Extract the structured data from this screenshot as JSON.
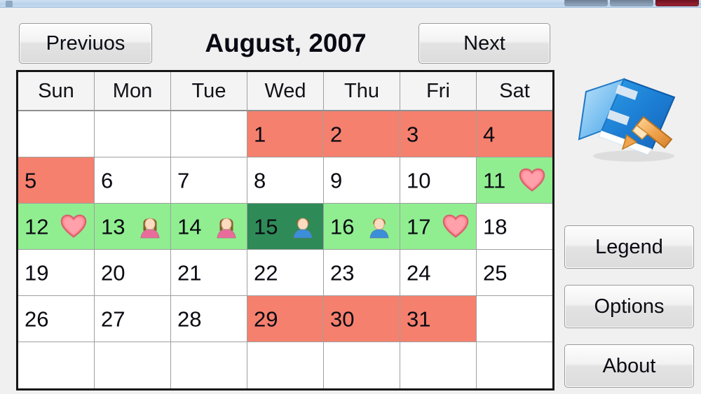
{
  "window": {
    "controls": [
      {
        "name": "minimize-button",
        "label": ""
      },
      {
        "name": "maximize-button",
        "label": ""
      },
      {
        "name": "close-button",
        "label": ""
      }
    ],
    "app_icon": "diary-book-pen-icon"
  },
  "toolbar": {
    "previous_label": "Previuos",
    "next_label": "Next",
    "month_title": "August, 2007"
  },
  "calendar": {
    "day_headers": [
      "Sun",
      "Mon",
      "Tue",
      "Wed",
      "Thu",
      "Fri",
      "Sat"
    ],
    "weeks": [
      [
        {
          "day": "",
          "state": "empty"
        },
        {
          "day": "",
          "state": "empty"
        },
        {
          "day": "",
          "state": "empty"
        },
        {
          "day": "1",
          "state": "red"
        },
        {
          "day": "2",
          "state": "red"
        },
        {
          "day": "3",
          "state": "red"
        },
        {
          "day": "4",
          "state": "red"
        }
      ],
      [
        {
          "day": "5",
          "state": "red"
        },
        {
          "day": "6",
          "state": "normal"
        },
        {
          "day": "7",
          "state": "normal"
        },
        {
          "day": "8",
          "state": "normal"
        },
        {
          "day": "9",
          "state": "normal"
        },
        {
          "day": "10",
          "state": "normal"
        },
        {
          "day": "11",
          "state": "green",
          "icon": "heart-icon"
        }
      ],
      [
        {
          "day": "12",
          "state": "green",
          "icon": "heart-icon"
        },
        {
          "day": "13",
          "state": "green",
          "icon": "female-person-icon"
        },
        {
          "day": "14",
          "state": "green",
          "icon": "female-person-icon"
        },
        {
          "day": "15",
          "state": "selected",
          "icon": "male-person-icon"
        },
        {
          "day": "16",
          "state": "green",
          "icon": "male-person-icon"
        },
        {
          "day": "17",
          "state": "green",
          "icon": "heart-icon"
        },
        {
          "day": "18",
          "state": "normal"
        }
      ],
      [
        {
          "day": "19",
          "state": "normal"
        },
        {
          "day": "20",
          "state": "normal"
        },
        {
          "day": "21",
          "state": "normal"
        },
        {
          "day": "22",
          "state": "normal"
        },
        {
          "day": "23",
          "state": "normal"
        },
        {
          "day": "24",
          "state": "normal"
        },
        {
          "day": "25",
          "state": "normal"
        }
      ],
      [
        {
          "day": "26",
          "state": "normal"
        },
        {
          "day": "27",
          "state": "normal"
        },
        {
          "day": "28",
          "state": "normal"
        },
        {
          "day": "29",
          "state": "red"
        },
        {
          "day": "30",
          "state": "red"
        },
        {
          "day": "31",
          "state": "red"
        },
        {
          "day": "",
          "state": "empty"
        }
      ],
      [
        {
          "day": "",
          "state": "empty"
        },
        {
          "day": "",
          "state": "empty"
        },
        {
          "day": "",
          "state": "empty"
        },
        {
          "day": "",
          "state": "empty"
        },
        {
          "day": "",
          "state": "empty"
        },
        {
          "day": "",
          "state": "empty"
        },
        {
          "day": "",
          "state": "empty"
        }
      ]
    ]
  },
  "sidebar": {
    "legend_label": "Legend",
    "options_label": "Options",
    "about_label": "About"
  },
  "colors": {
    "red_day": "#f5806e",
    "green_day": "#90ee90",
    "selected_day": "#2e8b57",
    "normal_day": "#ffffff",
    "heart": "#ff8b95",
    "female_icon": "#e86d9a",
    "male_icon": "#3b8ed8",
    "window_background": "#f0f0f0",
    "titlebar": "#b9d2ea",
    "close_button": "#9c2436"
  }
}
